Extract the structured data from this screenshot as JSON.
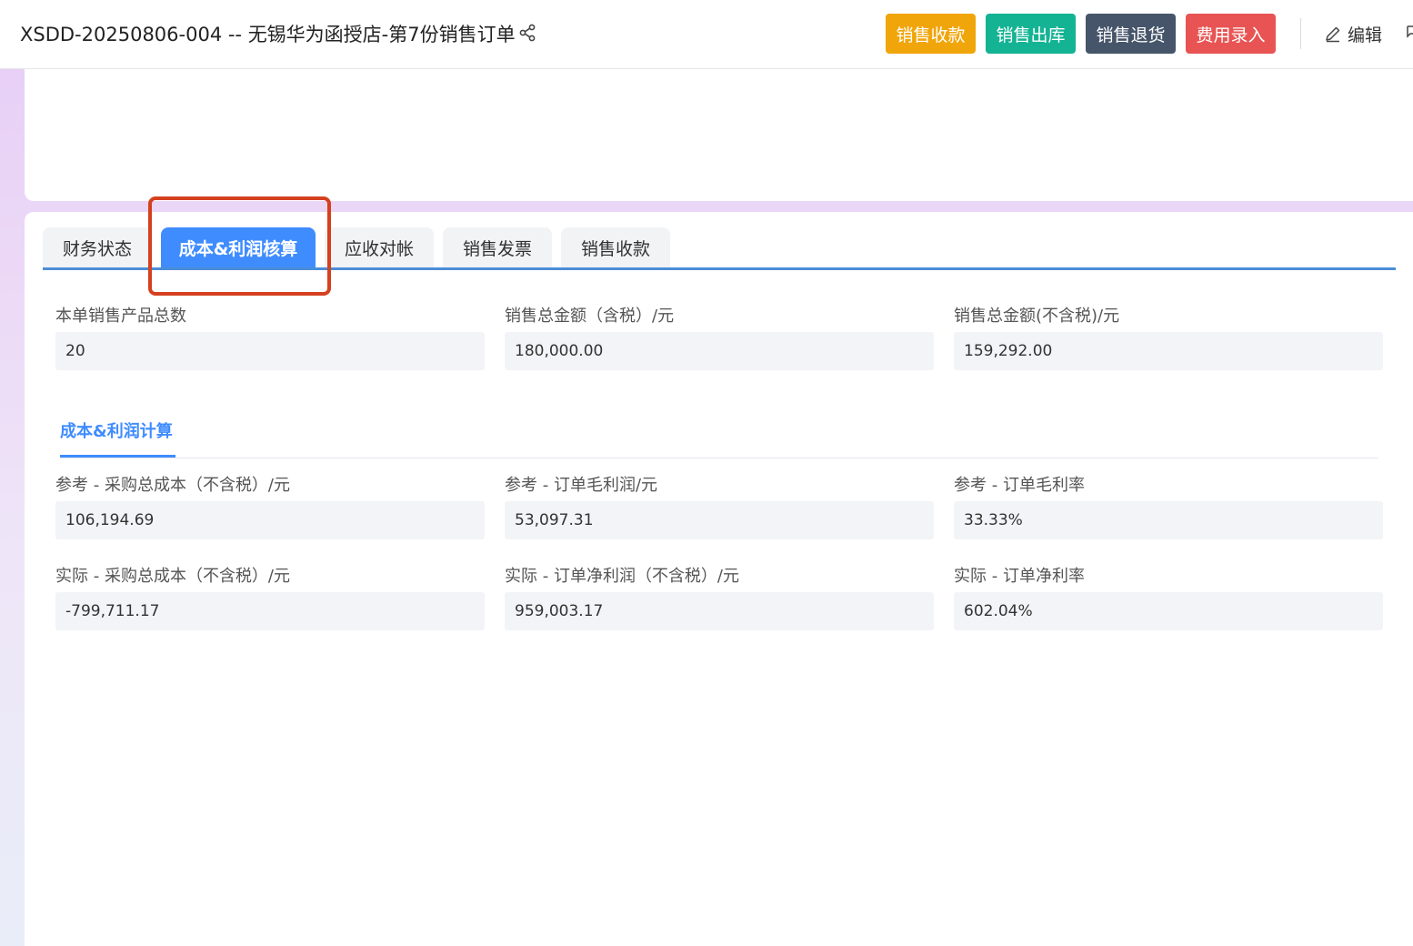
{
  "header": {
    "title": "XSDD-20250806-004 -- 无锡华为函授店-第7份销售订单",
    "buttons": [
      {
        "label": "销售收款",
        "color": "#f0a50a"
      },
      {
        "label": "销售出库",
        "color": "#14b394"
      },
      {
        "label": "销售退货",
        "color": "#46556a"
      },
      {
        "label": "费用录入",
        "color": "#e85453"
      }
    ],
    "edit_label": "编辑"
  },
  "tabs": [
    {
      "label": "财务状态",
      "active": false
    },
    {
      "label": "成本&利润核算",
      "active": true
    },
    {
      "label": "应收对帐",
      "active": false
    },
    {
      "label": "销售发票",
      "active": false
    },
    {
      "label": "销售收款",
      "active": false
    }
  ],
  "summary": [
    {
      "label": "本单销售产品总数",
      "value": "20"
    },
    {
      "label": "销售总金额（含税）/元",
      "value": "180,000.00"
    },
    {
      "label": "销售总金额(不含税)/元",
      "value": "159,292.00"
    }
  ],
  "section": {
    "title": "成本&利润计算"
  },
  "reference": [
    {
      "label": "参考 - 采购总成本（不含税）/元",
      "value": "106,194.69"
    },
    {
      "label": "参考 - 订单毛利润/元",
      "value": "53,097.31"
    },
    {
      "label": "参考 - 订单毛利率",
      "value": "33.33%"
    }
  ],
  "actual": [
    {
      "label": "实际 - 采购总成本（不含税）/元",
      "value": "-799,711.17"
    },
    {
      "label": "实际 - 订单净利润（不含税）/元",
      "value": "959,003.17"
    },
    {
      "label": "实际 - 订单净利率",
      "value": "602.04%"
    }
  ]
}
